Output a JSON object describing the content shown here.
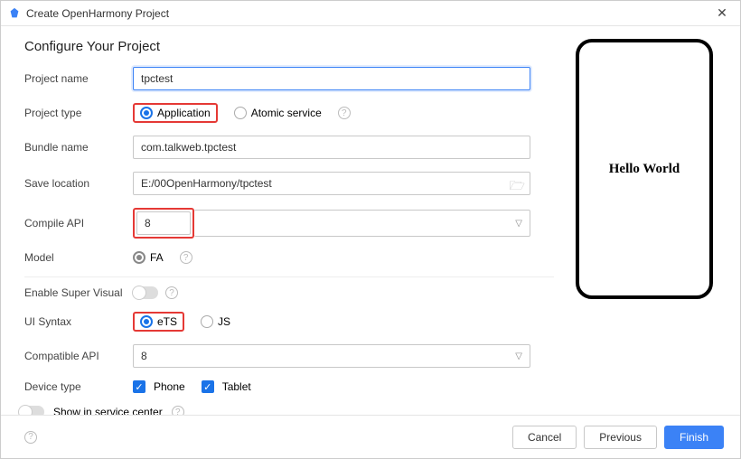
{
  "window": {
    "title": "Create OpenHarmony Project"
  },
  "heading": "Configure Your Project",
  "labels": {
    "project_name": "Project name",
    "project_type": "Project type",
    "bundle_name": "Bundle name",
    "save_location": "Save location",
    "compile_api": "Compile API",
    "model": "Model",
    "enable_super_visual": "Enable Super Visual",
    "ui_syntax": "UI Syntax",
    "compatible_api": "Compatible API",
    "device_type": "Device type",
    "show_in_service_center": "Show in service center"
  },
  "values": {
    "project_name": "tpctest",
    "bundle_name": "com.talkweb.tpctest",
    "save_location": "E:/00OpenHarmony/tpctest",
    "compile_api": "8",
    "compatible_api": "8"
  },
  "project_type": {
    "options": [
      "Application",
      "Atomic service"
    ],
    "selected": "Application"
  },
  "model": {
    "value": "FA"
  },
  "ui_syntax": {
    "options": [
      "eTS",
      "JS"
    ],
    "selected": "eTS"
  },
  "device_type": {
    "phone": {
      "label": "Phone",
      "checked": true
    },
    "tablet": {
      "label": "Tablet",
      "checked": true
    }
  },
  "preview": {
    "text": "Hello World"
  },
  "footer": {
    "cancel": "Cancel",
    "previous": "Previous",
    "finish": "Finish"
  },
  "help_glyph": "?"
}
